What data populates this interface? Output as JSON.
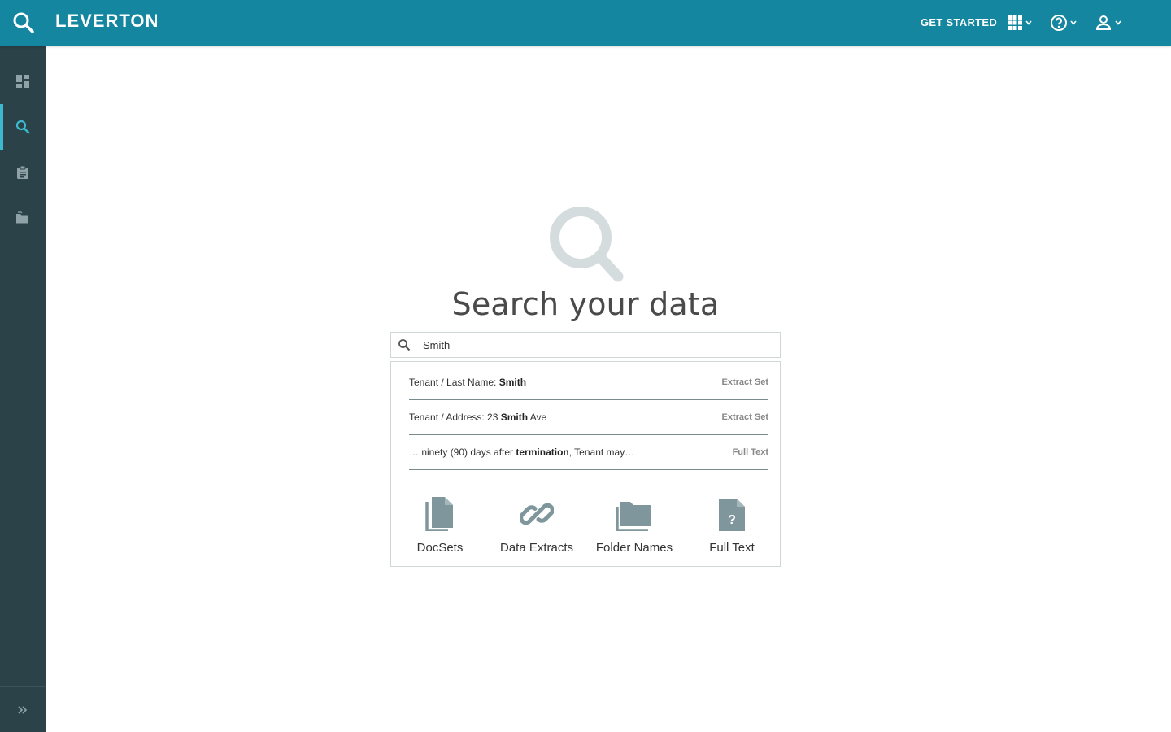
{
  "header": {
    "brand": "LEVERTON",
    "get_started": "GET STARTED",
    "apps_icon": "apps-grid-icon",
    "help_icon": "help-circle-icon",
    "user_icon": "user-icon",
    "color": "#15869f"
  },
  "sidebar": {
    "items": [
      {
        "icon": "dashboard-icon"
      },
      {
        "icon": "search-icon",
        "active": true
      },
      {
        "icon": "clipboard-icon"
      },
      {
        "icon": "folders-icon"
      }
    ],
    "footer_icon": "expand-chevrons-icon",
    "color": "#2b4248",
    "active_color": "#3db9cf"
  },
  "main": {
    "title": "Search your data",
    "search": {
      "value": "Smith"
    },
    "results": [
      {
        "prefix": "Tenant / Last Name: ",
        "highlight": "Smith",
        "suffix": "",
        "tag": "Extract Set"
      },
      {
        "prefix": "Tenant / Address: 23 ",
        "highlight": "Smith",
        "suffix": " Ave",
        "tag": "Extract Set"
      },
      {
        "prefix": "… ninety (90) days  after ",
        "highlight": "termination",
        "suffix": ", Tenant may…",
        "tag": "Full Text"
      }
    ],
    "categories": [
      {
        "label": "DocSets",
        "icon": "document-icon"
      },
      {
        "label": "Data Extracts",
        "icon": "link-icon"
      },
      {
        "label": "Folder Names",
        "icon": "folder-icon"
      },
      {
        "label": "Full Text",
        "icon": "document-question-icon"
      }
    ]
  }
}
